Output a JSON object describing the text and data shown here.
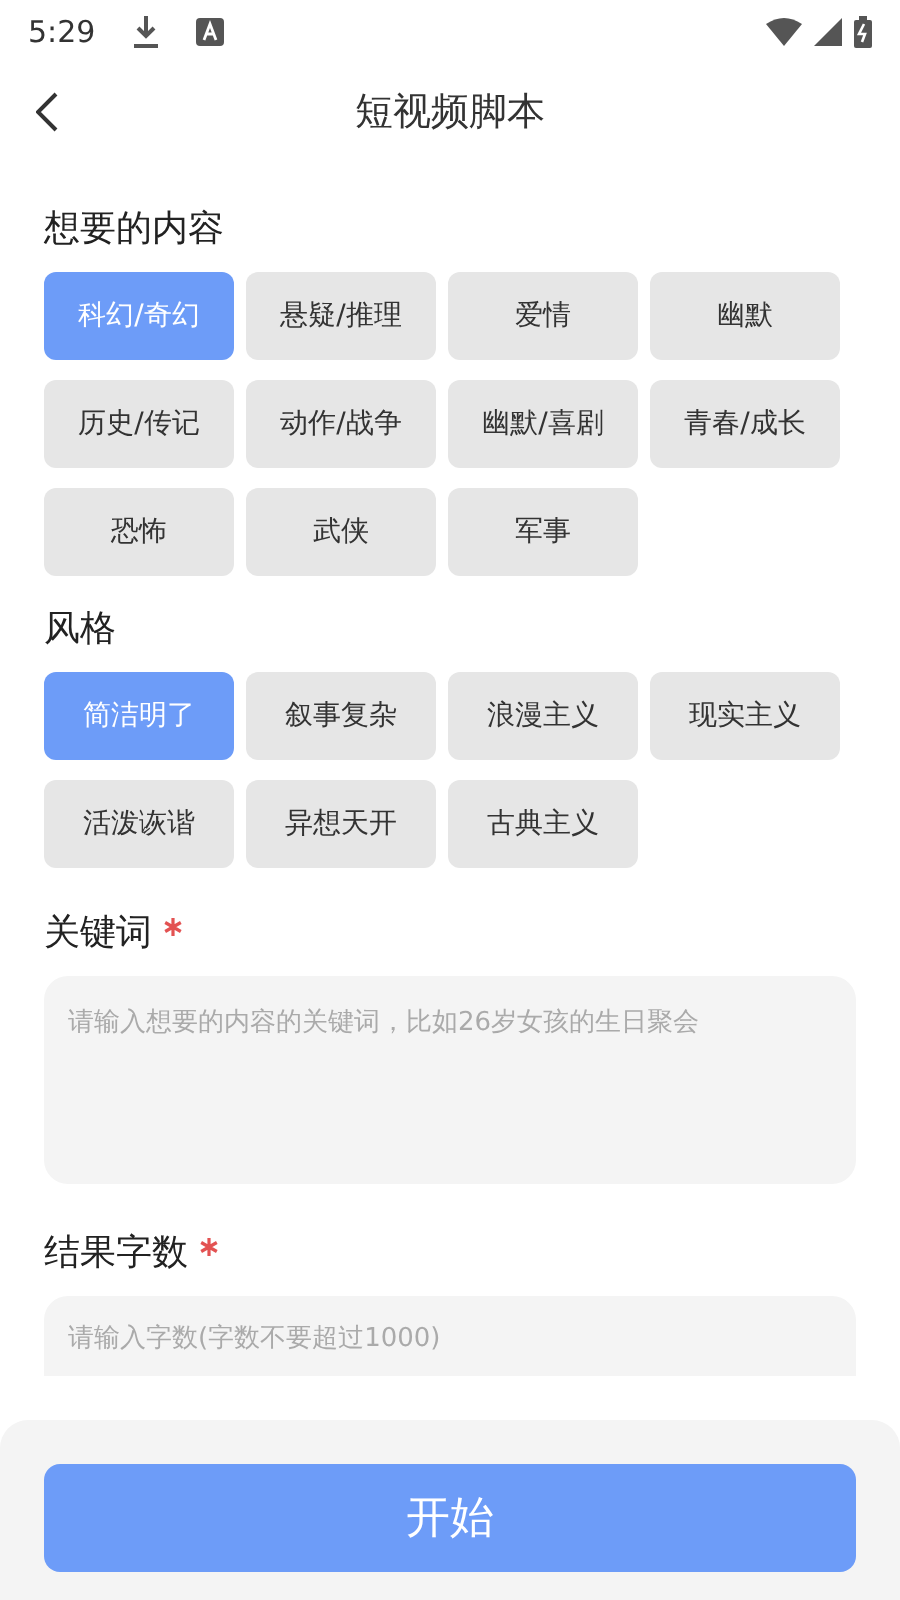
{
  "status_bar": {
    "time": "5:29"
  },
  "header": {
    "title": "短视频脚本"
  },
  "sections": [
    {
      "label": "想要的内容",
      "options": [
        {
          "label": "科幻/奇幻",
          "selected": true
        },
        {
          "label": "悬疑/推理",
          "selected": false
        },
        {
          "label": "爱情",
          "selected": false
        },
        {
          "label": "幽默",
          "selected": false
        },
        {
          "label": "历史/传记",
          "selected": false
        },
        {
          "label": "动作/战争",
          "selected": false
        },
        {
          "label": "幽默/喜剧",
          "selected": false
        },
        {
          "label": "青春/成长",
          "selected": false
        },
        {
          "label": "恐怖",
          "selected": false
        },
        {
          "label": "武侠",
          "selected": false
        },
        {
          "label": "军事",
          "selected": false
        }
      ]
    },
    {
      "label": "风格",
      "options": [
        {
          "label": "简洁明了",
          "selected": true
        },
        {
          "label": "叙事复杂",
          "selected": false
        },
        {
          "label": "浪漫主义",
          "selected": false
        },
        {
          "label": "现实主义",
          "selected": false
        },
        {
          "label": "活泼诙谐",
          "selected": false
        },
        {
          "label": "异想天开",
          "selected": false
        },
        {
          "label": "古典主义",
          "selected": false
        }
      ]
    }
  ],
  "fields": [
    {
      "label": "关键词",
      "required": true,
      "placeholder": "请输入想要的内容的关键词，比如26岁女孩的生日聚会",
      "kind": "textarea"
    },
    {
      "label": "结果字数",
      "required": true,
      "placeholder": "请输入字数(字数不要超过1000)",
      "kind": "input"
    }
  ],
  "submit_button": {
    "label": "开始"
  }
}
